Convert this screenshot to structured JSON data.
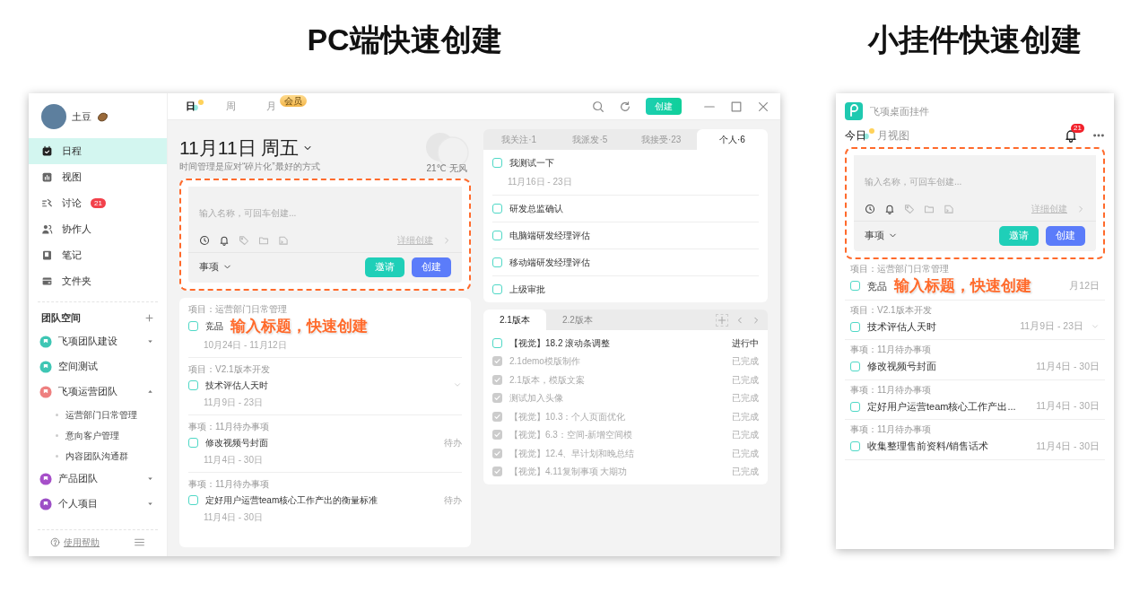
{
  "pc_section": {
    "heading": "PC端快速创建",
    "sidebar": {
      "user": {
        "name": "土豆"
      },
      "nav": [
        {
          "label": "日程",
          "selected": true
        },
        {
          "label": "视图",
          "selected": false
        },
        {
          "label": "讨论",
          "selected": false,
          "badge": "21"
        },
        {
          "label": "协作人",
          "selected": false
        },
        {
          "label": "笔记",
          "selected": false
        },
        {
          "label": "文件夹",
          "selected": false
        }
      ],
      "team_space": {
        "title": "团队空间",
        "teams": [
          {
            "name": "飞项团队建设",
            "color": "#3ec6b4",
            "kind": "group",
            "expanded": false
          },
          {
            "name": "空间测试",
            "color": "#3ec6b4",
            "kind": "single"
          },
          {
            "name": "飞项运营团队",
            "color": "#ee8080",
            "kind": "group",
            "expanded": true,
            "children": [
              "运营部门日常管理",
              "意向客户管理",
              "内容团队沟通群"
            ]
          },
          {
            "name": "产品团队",
            "color": "#a64fc9",
            "kind": "group",
            "expanded": false
          },
          {
            "name": "个人项目",
            "color": "#9d4fc6",
            "kind": "group",
            "expanded": false
          }
        ]
      },
      "help": "使用帮助"
    },
    "view_tabs": [
      {
        "label": "日",
        "selected": true
      },
      {
        "label": "周",
        "selected": false
      },
      {
        "label": "月",
        "selected": false,
        "badge": "会员"
      }
    ],
    "top_create": "创建",
    "date_title": "11月11日 周五",
    "date_subtitle": "时间管理是应对“碎片化”最好的方式",
    "weather": "21℃ 无风",
    "quick_create": {
      "placeholder": "输入名称，可回车创建...",
      "detail": "详细创建",
      "type": "事项",
      "invite": "邀请",
      "create": "创建"
    },
    "annotation": "输入标题，快速创建",
    "tasks": [
      {
        "category": "项目：运营部门日常管理",
        "title": "竞品",
        "date": "10月24日 - 11月12日",
        "checked": false,
        "has_subtasks": false
      },
      {
        "category": "项目：V2.1版本开发",
        "title": "技术评估人天时",
        "date": "11月9日 - 23日",
        "checked": false,
        "has_subtasks": true
      },
      {
        "category": "事项：11月待办事项",
        "title": "修改视频号封面",
        "date": "11月4日 - 30日",
        "status": "待办",
        "checked": false,
        "has_subtasks": false
      },
      {
        "category": "事项：11月待办事项",
        "title": "定好用户运营team核心工作产出的衡量标准",
        "date": "11月4日 - 30日",
        "status": "待办",
        "checked": false,
        "has_subtasks": false
      }
    ],
    "filter_tabs": [
      {
        "label": "我关注·1",
        "selected": false
      },
      {
        "label": "我派发·5",
        "selected": false
      },
      {
        "label": "我接受·23",
        "selected": false
      },
      {
        "label": "个人·6",
        "selected": true
      }
    ],
    "personal_items": [
      {
        "title": "我测试一下",
        "date": "11月16日 - 23日",
        "checked": false
      },
      {
        "title": "研发总监确认",
        "checked": false
      },
      {
        "title": "电脑端研发经理评估",
        "checked": false
      },
      {
        "title": "移动端研发经理评估",
        "checked": false
      },
      {
        "title": "上级审批",
        "checked": false
      }
    ],
    "version_tabs": [
      {
        "label": "2.1版本",
        "selected": true
      },
      {
        "label": "2.2版本",
        "selected": false
      }
    ],
    "version_items": [
      {
        "title": "【视觉】18.2 滚动条调整",
        "status": "进行中",
        "done": false
      },
      {
        "title": "2.1demo模版制作",
        "status": "已完成",
        "done": true
      },
      {
        "title": "2.1版本，模版文案",
        "status": "已完成",
        "done": true
      },
      {
        "title": "测试加入头像",
        "status": "已完成",
        "done": true
      },
      {
        "title": "【视觉】10.3：个人页面优化",
        "status": "已完成",
        "done": true
      },
      {
        "title": "【视觉】6.3：空间-新增空间模",
        "status": "已完成",
        "done": true
      },
      {
        "title": "【视觉】12.4、早计划和晚总结",
        "status": "已完成",
        "done": true
      },
      {
        "title": "【视觉】4.11复制事项 大期功",
        "status": "已完成",
        "done": true
      }
    ]
  },
  "widget_section": {
    "heading": "小挂件快速创建",
    "title": "飞项桌面挂件",
    "tabs": [
      {
        "label": "今日",
        "selected": true
      },
      {
        "label": "月视图",
        "selected": false
      }
    ],
    "bell_badge": "21",
    "quick_create": {
      "placeholder": "输入名称，可回车创建...",
      "detail": "详细创建",
      "type": "事项",
      "invite": "邀请",
      "create": "创建"
    },
    "annotation": "输入标题，快速创建",
    "tasks": [
      {
        "category": "项目：运营部门日常管理",
        "title": "竞品",
        "date": "月12日",
        "checked": false,
        "has_subtasks": false
      },
      {
        "category": "项目：V2.1版本开发",
        "title": "技术评估人天时",
        "date": "11月9日 - 23日",
        "checked": false,
        "has_subtasks": true
      },
      {
        "category": "事项：11月待办事项",
        "title": "修改视频号封面",
        "date": "11月4日 - 30日",
        "checked": false,
        "has_subtasks": false
      },
      {
        "category": "事项：11月待办事项",
        "title": "定好用户运营team核心工作产出...",
        "date": "11月4日 - 30日",
        "checked": false,
        "has_subtasks": false
      },
      {
        "category": "事项：11月待办事项",
        "title": "收集整理售前资料/销售话术",
        "date": "11月4日 - 30日",
        "checked": false,
        "has_subtasks": false
      }
    ]
  }
}
